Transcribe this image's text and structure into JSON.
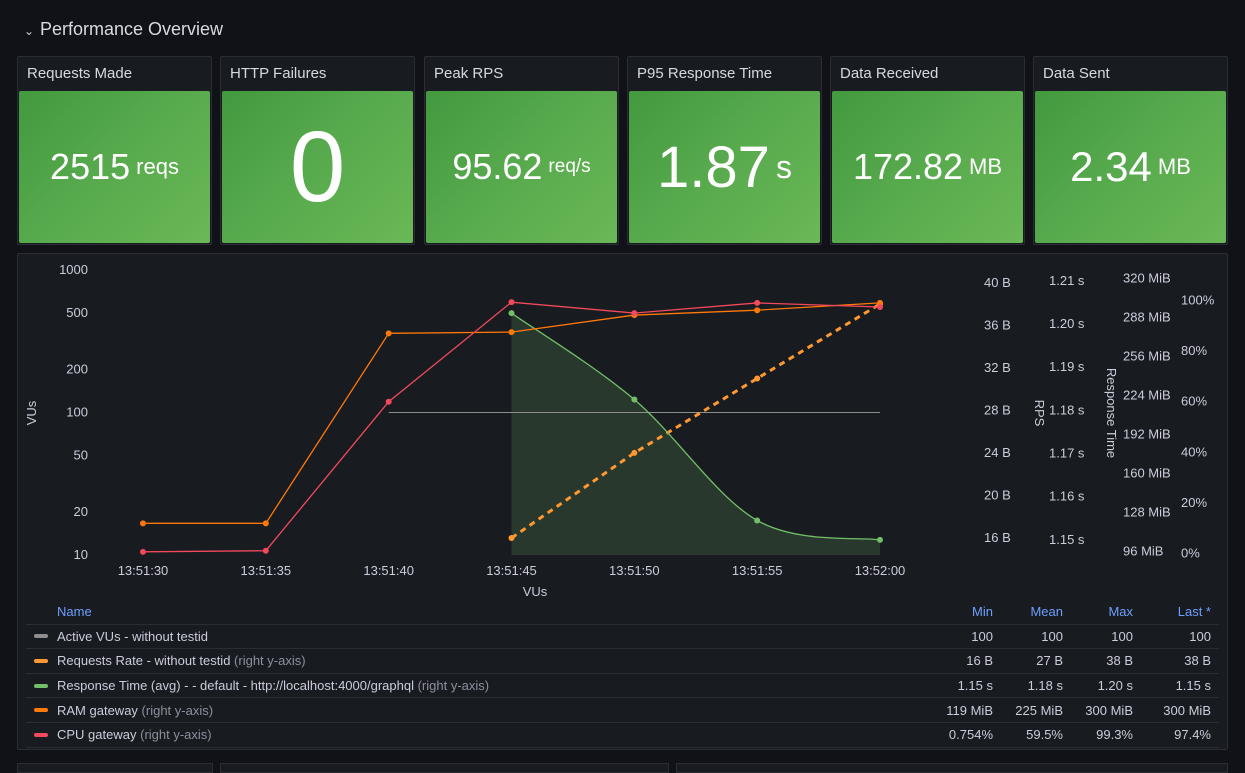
{
  "row": {
    "title": "Performance Overview",
    "collapse_icon": "chevron-down-icon"
  },
  "stats": [
    {
      "title": "Requests Made",
      "value": "2515",
      "unit": "reqs"
    },
    {
      "title": "HTTP Failures",
      "value": "0",
      "unit": ""
    },
    {
      "title": "Peak RPS",
      "value": "95.62",
      "unit": "req/s"
    },
    {
      "title": "P95 Response Time",
      "value": "1.87",
      "unit": "s"
    },
    {
      "title": "Data Received",
      "value": "172.82",
      "unit": "MB"
    },
    {
      "title": "Data Sent",
      "value": "2.34",
      "unit": "MB"
    }
  ],
  "stat_color": "#56a94c",
  "chart_data": {
    "type": "line",
    "x": [
      "13:51:30",
      "13:51:35",
      "13:51:40",
      "13:51:45",
      "13:51:50",
      "13:51:55",
      "13:52:00"
    ],
    "xlabel": "VUs",
    "axes": {
      "left": {
        "label": "VUs",
        "scale": "log",
        "ticks": [
          "1000",
          "500",
          "200",
          "100",
          "50",
          "20",
          "10"
        ],
        "range": [
          10,
          1000
        ]
      },
      "right_rps": {
        "label": "RPS",
        "ticks": [
          "40 B",
          "36 B",
          "32 B",
          "28 B",
          "24 B",
          "20 B",
          "16 B"
        ],
        "range": [
          14.4,
          41.2
        ]
      },
      "right_response": {
        "label": "Response Time",
        "ticks": [
          "1.21 s",
          "1.20 s",
          "1.19 s",
          "1.18 s",
          "1.17 s",
          "1.16 s",
          "1.15 s"
        ],
        "range": [
          1.1465,
          1.2125
        ]
      },
      "right_ram": {
        "label": "",
        "ticks": [
          "320 MiB",
          "288 MiB",
          "256 MiB",
          "224 MiB",
          "192 MiB",
          "160 MiB",
          "128 MiB",
          "96 MiB"
        ],
        "range": [
          93,
          327
        ]
      },
      "right_cpu": {
        "label": "",
        "ticks": [
          "100%",
          "80%",
          "60%",
          "40%",
          "20%",
          "0%"
        ],
        "range": [
          -0.5,
          112
        ]
      }
    },
    "series": [
      {
        "name": "Active VUs - without testid",
        "axis": "left",
        "color": "#8e8e8e",
        "style": "line",
        "x": [
          "13:51:40",
          "13:52:00"
        ],
        "values": [
          100,
          100
        ]
      },
      {
        "name": "Requests Rate - without testid",
        "axis": "right_rps",
        "color": "#ff9830",
        "style": "dashed",
        "x": [
          "13:51:45",
          "13:51:50",
          "13:51:55",
          "13:52:00"
        ],
        "values": [
          16,
          24,
          31,
          38
        ]
      },
      {
        "name": "Response Time (avg) - - default - http://localhost:4000/graphql",
        "axis": "right_response",
        "color": "#73bf69",
        "style": "area",
        "x": [
          "13:51:45",
          "13:51:50",
          "13:51:55",
          "13:52:00"
        ],
        "values": [
          1.2025,
          1.1825,
          1.1545,
          1.15
        ]
      },
      {
        "name": "RAM gateway",
        "axis": "right_ram",
        "color": "#ff780a",
        "style": "line",
        "x": [
          "13:51:30",
          "13:51:35",
          "13:51:40",
          "13:51:45",
          "13:51:50",
          "13:51:55",
          "13:52:00"
        ],
        "values": [
          119,
          119,
          275,
          276,
          290,
          294,
          300
        ]
      },
      {
        "name": "CPU gateway",
        "axis": "right_cpu",
        "color": "#f2495c",
        "style": "line",
        "x": [
          "13:51:30",
          "13:51:35",
          "13:51:40",
          "13:51:45",
          "13:51:50",
          "13:51:55",
          "13:52:00"
        ],
        "values": [
          0.754,
          1.2,
          60,
          99.3,
          95,
          99.0,
          97.4
        ]
      }
    ]
  },
  "legend": {
    "headers": {
      "name": "Name",
      "min": "Min",
      "mean": "Mean",
      "max": "Max",
      "last": "Last *"
    },
    "rows": [
      {
        "name": "Active VUs - without testid",
        "axis_note": "",
        "color": "#8e8e8e",
        "min": "100",
        "mean": "100",
        "max": "100",
        "last": "100"
      },
      {
        "name": "Requests Rate - without testid",
        "axis_note": "(right y-axis)",
        "color": "#ff9830",
        "min": "16 B",
        "mean": "27 B",
        "max": "38 B",
        "last": "38 B"
      },
      {
        "name": "Response Time (avg) - - default - http://localhost:4000/graphql",
        "axis_note": "(right y-axis)",
        "color": "#73bf69",
        "min": "1.15 s",
        "mean": "1.18 s",
        "max": "1.20 s",
        "last": "1.15 s"
      },
      {
        "name": "RAM gateway",
        "axis_note": "(right y-axis)",
        "color": "#ff780a",
        "min": "119 MiB",
        "mean": "225 MiB",
        "max": "300 MiB",
        "last": "300 MiB"
      },
      {
        "name": "CPU gateway",
        "axis_note": "(right y-axis)",
        "color": "#f2495c",
        "min": "0.754%",
        "mean": "59.5%",
        "max": "99.3%",
        "last": "97.4%"
      }
    ]
  }
}
